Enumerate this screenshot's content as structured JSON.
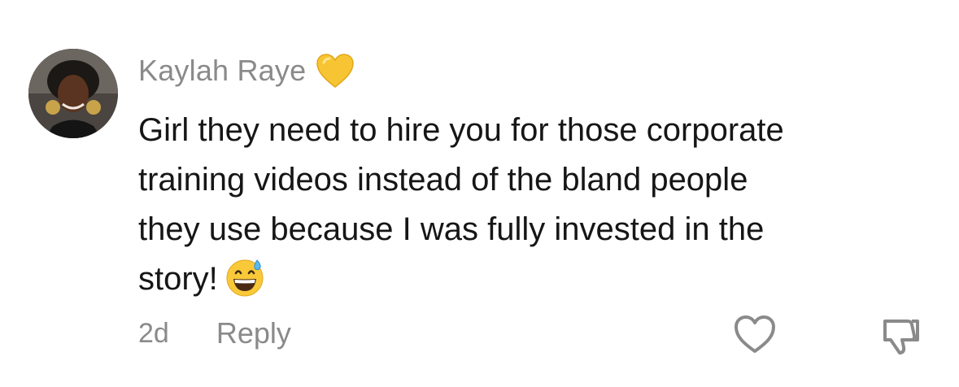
{
  "comment": {
    "author": "Kaylah Raye",
    "author_badge_icon": "yellow-heart-emoji",
    "text_lines": [
      "Girl they need to hire you for those corporate",
      "training videos instead of the bland people",
      "they use because I was fully invested in the",
      "story!"
    ],
    "trailing_emoji_icon": "grinning-face-with-sweat-emoji",
    "time": "2d",
    "reply_label": "Reply",
    "like_icon": "heart-outline-icon",
    "dislike_icon": "thumbs-down-icon"
  },
  "colors": {
    "text_primary": "#161616",
    "text_secondary": "#8a8a8a",
    "heart_emoji": "#f7c534",
    "background": "#ffffff"
  }
}
